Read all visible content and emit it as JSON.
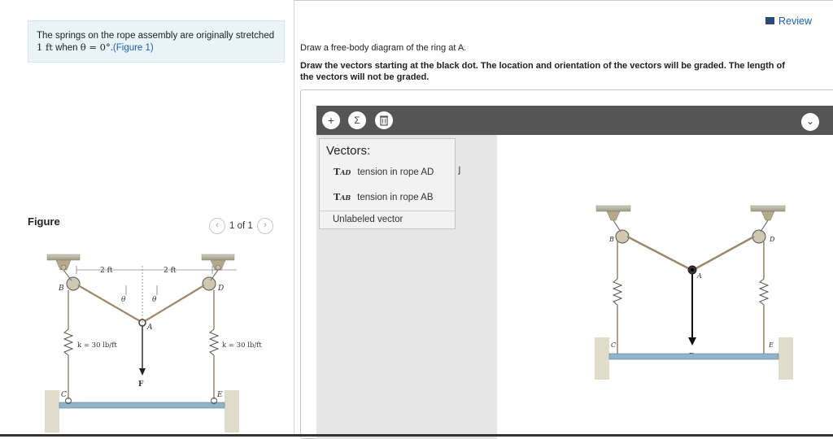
{
  "problem": {
    "text_before": "The springs on the rope assembly are originally stretched",
    "dist_value": "1 ft",
    "when_text": "when",
    "theta_expr": "θ = 0°",
    "dot": ".",
    "figure_link": "(Figure 1)"
  },
  "figure": {
    "heading": "Figure",
    "prev_icon": "‹",
    "next_icon": "›",
    "counter": "1 of 1",
    "labels": {
      "dim_left": "2 ft",
      "dim_right": "2 ft",
      "theta": "θ",
      "A": "A",
      "B": "B",
      "C": "C",
      "D": "D",
      "E": "E",
      "F": "F",
      "k_left": "k = 30 lb/ft",
      "k_right": "k = 30 lb/ft"
    }
  },
  "review": {
    "label": "Review"
  },
  "instructions": {
    "line1": "Draw a free-body diagram of the ring at A.",
    "line2": "Draw the vectors starting at the black dot. The location and orientation of the vectors will be graded. The length of the vectors will not be graded."
  },
  "toolbar": {
    "add_icon": "+",
    "sum_icon": "Σ",
    "trash_icon": "trash-icon",
    "dropdown_icon": "⌄"
  },
  "vectors_menu": {
    "title": "Vectors:",
    "items": [
      {
        "symbol": "T",
        "sub": "AD",
        "desc": "tension in rope AD"
      },
      {
        "symbol": "T",
        "sub": "AB",
        "desc": "tension in rope AB"
      }
    ],
    "unlabeled": "Unlabeled vector"
  },
  "canvas": {
    "labels": {
      "A": "A",
      "B": "B",
      "C": "C",
      "D": "D",
      "E": "E",
      "F": "F"
    }
  },
  "colors": {
    "link": "#1a5fb4",
    "toolbar": "#555555",
    "problem_bg": "#e8f4f8"
  }
}
